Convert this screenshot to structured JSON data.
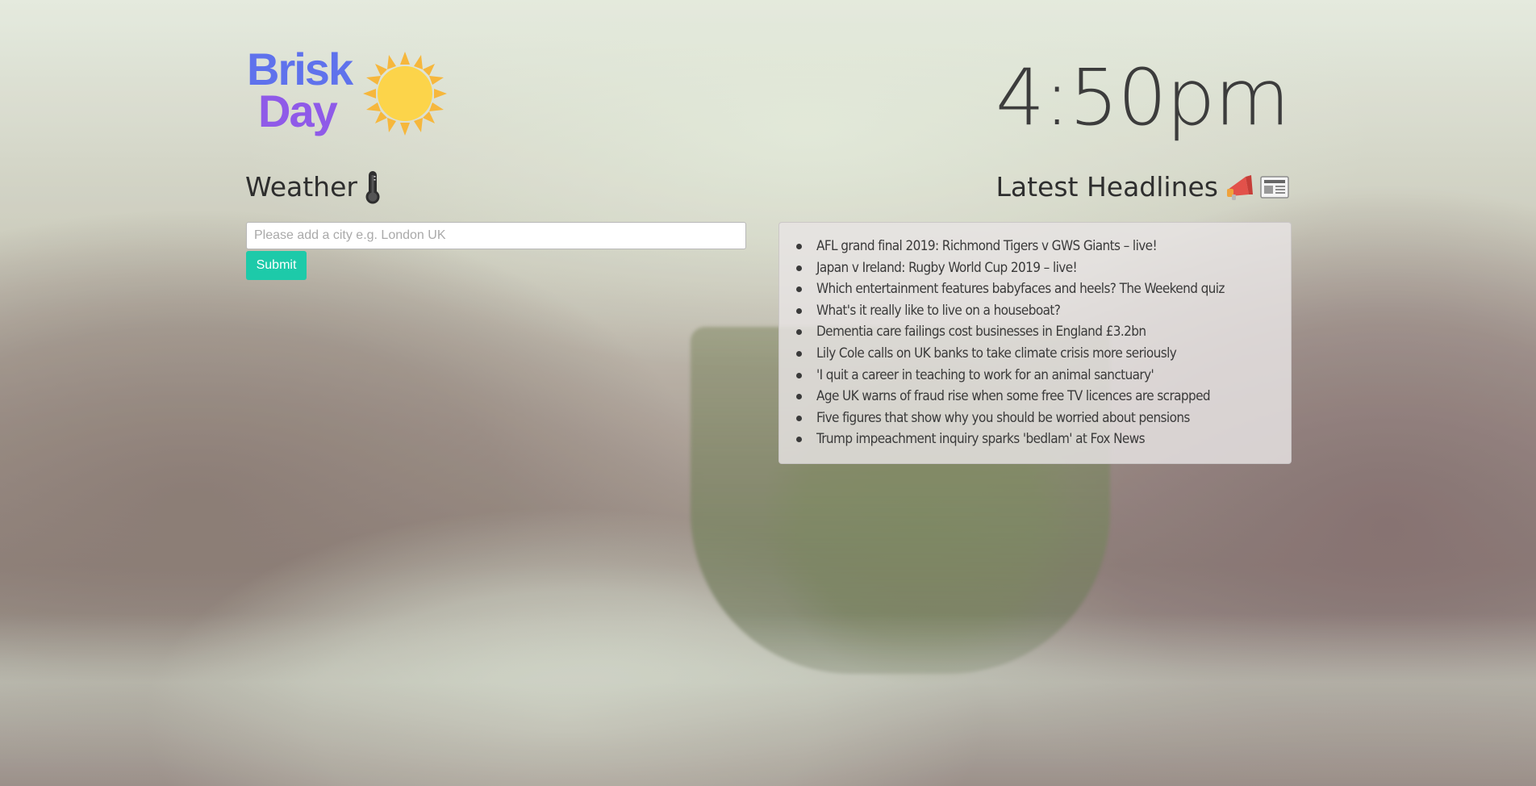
{
  "app": {
    "logo_line1": "Brisk",
    "logo_line2": "Day",
    "logo_icon": "sun-icon"
  },
  "clock": {
    "time": "4:50pm"
  },
  "weather": {
    "title": "Weather",
    "title_icon": "thermometer-icon",
    "city_placeholder": "Please add a city e.g. London UK",
    "city_value": "",
    "submit_label": "Submit",
    "submit_color": "#1dcaa9"
  },
  "headlines": {
    "title": "Latest Headlines",
    "title_icons": [
      "megaphone-icon",
      "newspaper-icon"
    ],
    "items": [
      "AFL grand final 2019: Richmond Tigers v GWS Giants – live!",
      "Japan v Ireland: Rugby World Cup 2019 – live!",
      "Which entertainment features babyfaces and heels? The Weekend quiz",
      "What's it really like to live on a houseboat?",
      "Dementia care failings cost businesses in England £3.2bn",
      "Lily Cole calls on UK banks to take climate crisis more seriously",
      "'I quit a career in teaching to work for an animal sanctuary'",
      "Age UK warns of fraud rise when some free TV licences are scrapped",
      "Five figures that show why you should be worried about pensions",
      "Trump impeachment inquiry sparks 'bedlam' at Fox News"
    ]
  },
  "colors": {
    "logo_brisk": "#5f72ec",
    "logo_day": "#8f5ae8",
    "sun": "#fbc93a"
  }
}
